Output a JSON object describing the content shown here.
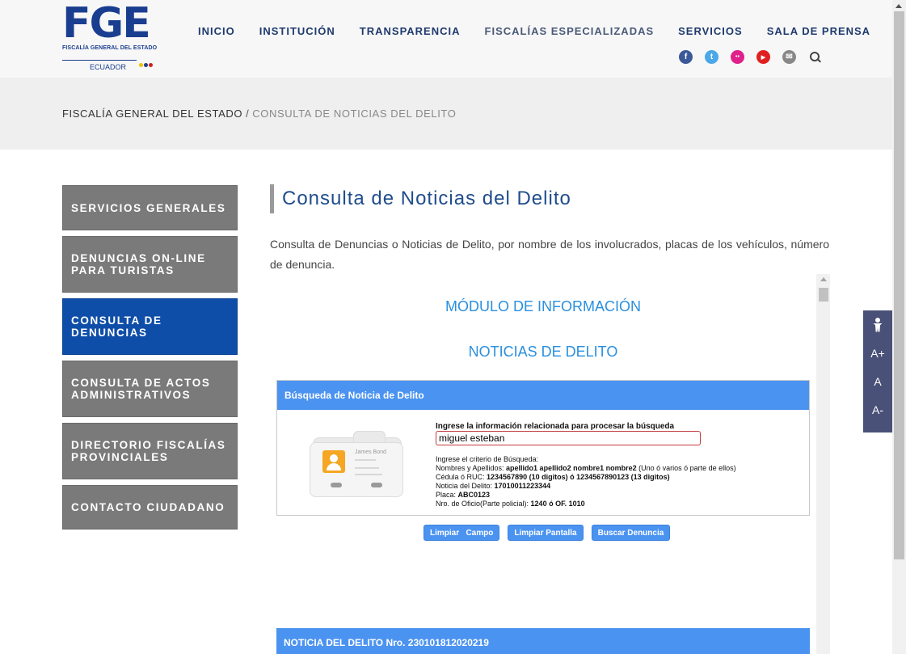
{
  "logo": {
    "abbr": "FGE",
    "subtitle": "FISCALÍA GENERAL DEL ESTADO",
    "country": "ECUADOR"
  },
  "nav": [
    {
      "label": "INICIO"
    },
    {
      "label": "INSTITUCIÓN"
    },
    {
      "label": "TRANSPARENCIA"
    },
    {
      "label": "FISCALÍAS ESPECIALIZADAS"
    },
    {
      "label": "SERVICIOS"
    },
    {
      "label": "SALA DE PRENSA"
    }
  ],
  "social": [
    {
      "icon": "facebook-icon",
      "glyph": "f",
      "color": "#3b5998"
    },
    {
      "icon": "twitter-icon",
      "glyph": "t",
      "color": "#4aa8e8"
    },
    {
      "icon": "flickr-icon",
      "glyph": "••",
      "color": "#e0218a"
    },
    {
      "icon": "youtube-icon",
      "glyph": "▶",
      "color": "#e02020"
    },
    {
      "icon": "mail-icon",
      "glyph": "✉",
      "color": "#888888"
    }
  ],
  "breadcrumb": {
    "root": "FISCALÍA GENERAL DEL ESTADO",
    "separator": "/",
    "current": "CONSULTA DE NOTICIAS DEL DELITO"
  },
  "sidebar": {
    "items": [
      {
        "label": "SERVICIOS GENERALES",
        "active": false
      },
      {
        "label": "DENUNCIAS ON-LINE PARA TURISTAS",
        "active": false
      },
      {
        "label": "CONSULTA DE DENUNCIAS",
        "active": true
      },
      {
        "label": "CONSULTA DE ACTOS ADMINISTRATIVOS",
        "active": false
      },
      {
        "label": "DIRECTORIO FISCALÍAS PROVINCIALES",
        "active": false
      },
      {
        "label": "CONTACTO CIUDADANO",
        "active": false
      }
    ]
  },
  "main": {
    "title": "Consulta de Noticias del Delito",
    "intro": "Consulta de Denuncias o Noticias de Delito, por nombre de los involucrados, placas de los vehículos, número de denuncia."
  },
  "module": {
    "heading1": "MÓDULO DE INFORMACIÓN",
    "heading2": "NOTICIAS DE DELITO",
    "search_card": {
      "header": "Búsqueda de Noticia de Delito",
      "illustration_name": "James Bond",
      "label": "Ingrese la información relacionada para procesar la búsqueda",
      "input_value": "miguel esteban",
      "criteria_title": "Ingrese el criterio de Búsqueda:",
      "criteria": [
        {
          "prefix": "Nombres y Apellidos: ",
          "bold": "apellido1 apellido2 nombre1 nombre2",
          "suffix": " (Uno ó varios ó parte de ellos)"
        },
        {
          "prefix": "Cédula ó RUC: ",
          "bold": "1234567890 (10 digitos) ó 1234567890123 (13 digitos)",
          "suffix": ""
        },
        {
          "prefix": "Noticia del Delito: ",
          "bold": "17010011223344",
          "suffix": ""
        },
        {
          "prefix": "Placa: ",
          "bold": "ABC0123",
          "suffix": ""
        },
        {
          "prefix": "Nro. de Oficio(Parte policial): ",
          "bold": "1240 ó OF. 1010",
          "suffix": ""
        }
      ]
    },
    "buttons": {
      "clear_field": "Limpiar   Campo",
      "clear_screen": "Limpiar Pantalla",
      "search": "Buscar Denuncia"
    },
    "result_header": "NOTICIA DEL DELITO Nro. 230101812020219"
  },
  "accessibility": {
    "increase": "A+",
    "normal": "A",
    "decrease": "A-"
  },
  "colors": {
    "brand": "#1a3e8f",
    "sidebar_active": "#0f4ea8",
    "sidebar_default": "#7a7a7a",
    "card_header": "#4b93f0",
    "module_heading": "#2a8fde"
  }
}
